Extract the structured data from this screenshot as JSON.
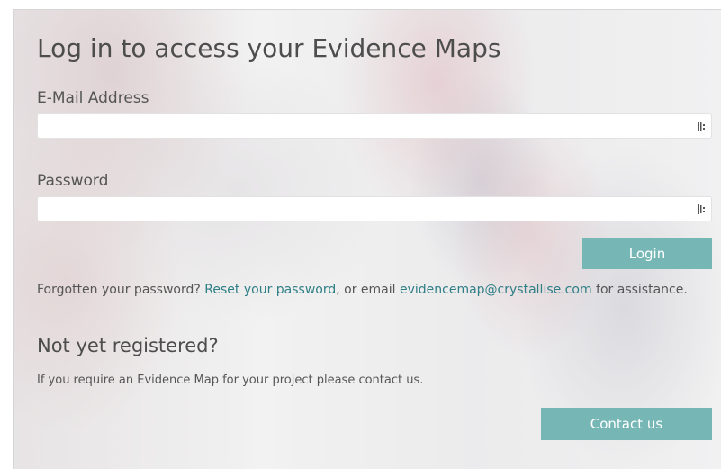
{
  "login": {
    "title": "Log in to access your Evidence Maps",
    "email_label": "E-Mail Address",
    "email_value": "",
    "password_label": "Password",
    "password_value": "",
    "field_icon": "password-manager-icon",
    "login_button": "Login"
  },
  "help": {
    "text_before": "Forgotten your password? ",
    "reset_link": "Reset your password",
    "text_middle": ", or email ",
    "email_link": "evidencemap@crystallise.com",
    "text_after": " for assistance."
  },
  "register": {
    "heading": "Not yet registered?",
    "text": "If you require an Evidence Map for your project please contact us.",
    "contact_button": "Contact us"
  },
  "colors": {
    "accent": "#76b7b6",
    "link": "#2e7f86",
    "text": "#4d4d4d"
  }
}
